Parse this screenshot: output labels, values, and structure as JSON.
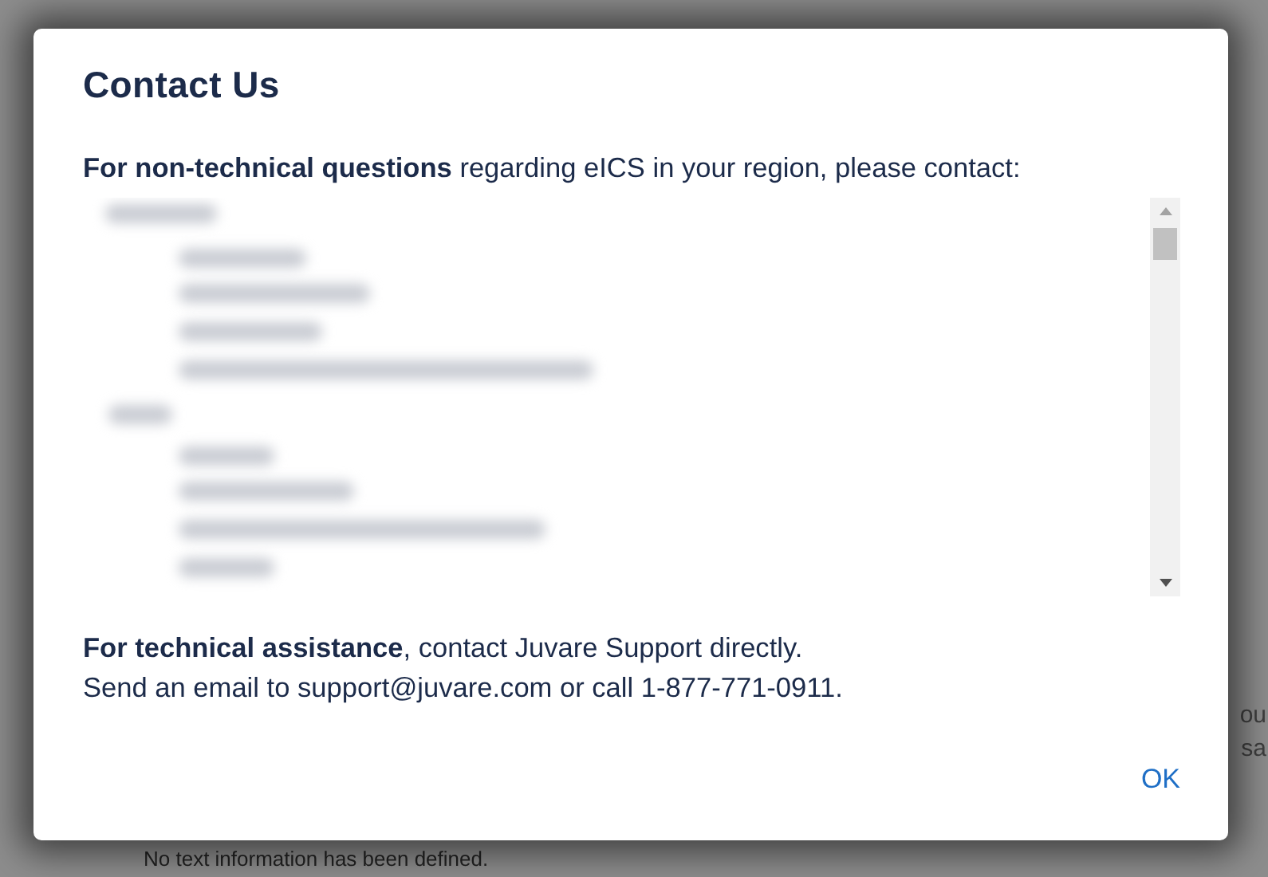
{
  "background": {
    "fragments": [
      "ou",
      "sa"
    ],
    "note": "No text information has been defined."
  },
  "dialog": {
    "title": "Contact Us",
    "intro": "**For non-technical questions** regarding eICS in your region, please contact:",
    "technical": "**For technical assistance**, contact Juvare Support directly.",
    "contact_line": "Send an email to support@juvare.com or call 1-877-771-0911.",
    "buttons": [
      "OK"
    ]
  }
}
